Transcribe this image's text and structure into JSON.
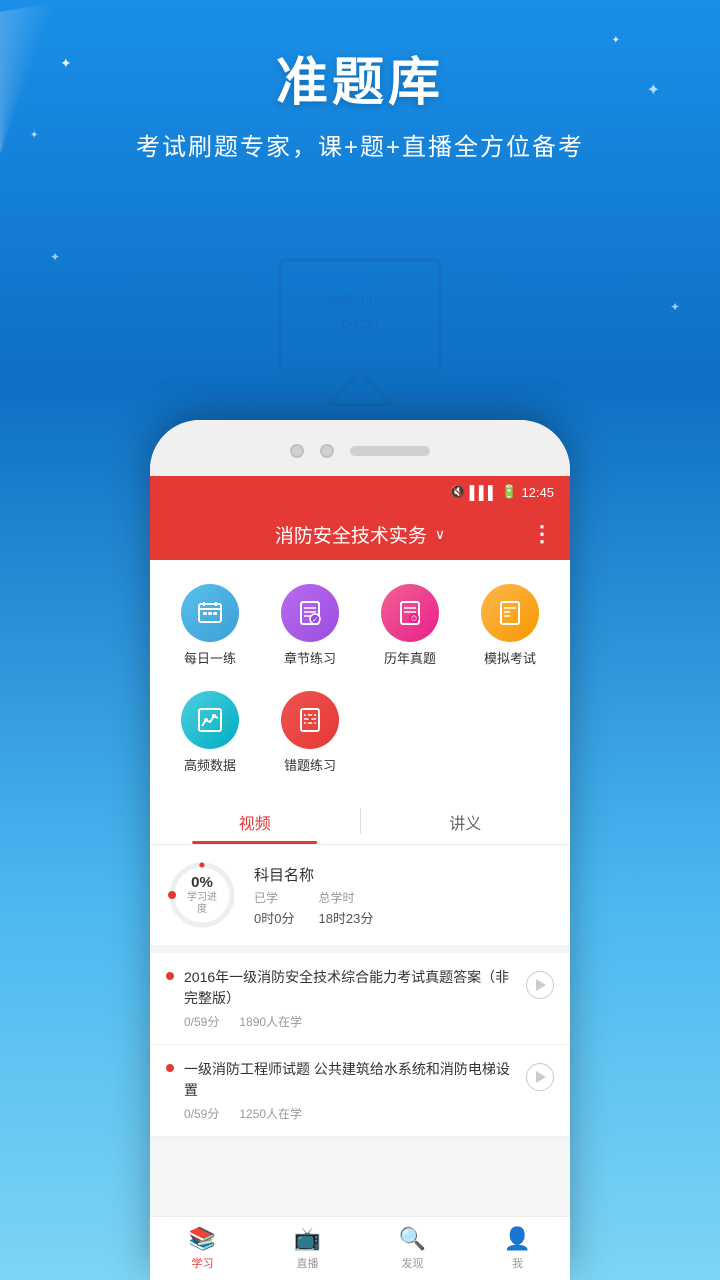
{
  "hero": {
    "title": "准题库",
    "subtitle": "考试刷题专家，课+题+直播全方位备考"
  },
  "status_bar": {
    "time": "12:45",
    "signal": "📶",
    "battery": "🔋"
  },
  "app_header": {
    "title": "消防安全技术实务",
    "dropdown_icon": "∨",
    "more_icon": "⋮"
  },
  "icon_grid": {
    "items": [
      {
        "label": "每日一练",
        "color_class": "ic-blue",
        "icon": "📅"
      },
      {
        "label": "章节练习",
        "color_class": "ic-purple",
        "icon": "📋"
      },
      {
        "label": "历年真题",
        "color_class": "ic-pink",
        "icon": "📄"
      },
      {
        "label": "模拟考试",
        "color_class": "ic-orange",
        "icon": "📝"
      },
      {
        "label": "高频数据",
        "color_class": "ic-teal",
        "icon": "📊"
      },
      {
        "label": "错题练习",
        "color_class": "ic-red",
        "icon": "📑"
      }
    ]
  },
  "tabs": {
    "items": [
      {
        "label": "视频",
        "active": true
      },
      {
        "label": "讲义",
        "active": false
      }
    ]
  },
  "progress": {
    "percent": "0%",
    "label": "学习进度",
    "subject_name": "科目名称",
    "studied_label": "已学",
    "studied_value": "0时0分",
    "total_label": "总学时",
    "total_value": "18时23分"
  },
  "courses": [
    {
      "title": "2016年一级消防安全技术综合能力考试真题答案（非完整版）",
      "progress": "0/59分",
      "students": "1890人在学"
    },
    {
      "title": "一级消防工程师试题 公共建筑给水系统和消防电梯设置",
      "progress": "0/59分",
      "students": "1250人在学"
    }
  ],
  "bottom_nav": {
    "items": [
      {
        "label": "学习",
        "active": true,
        "icon": "📚"
      },
      {
        "label": "直播",
        "active": false,
        "icon": "📺"
      },
      {
        "label": "发现",
        "active": false,
        "icon": "🔍"
      },
      {
        "label": "我",
        "active": false,
        "icon": "👤"
      }
    ]
  }
}
